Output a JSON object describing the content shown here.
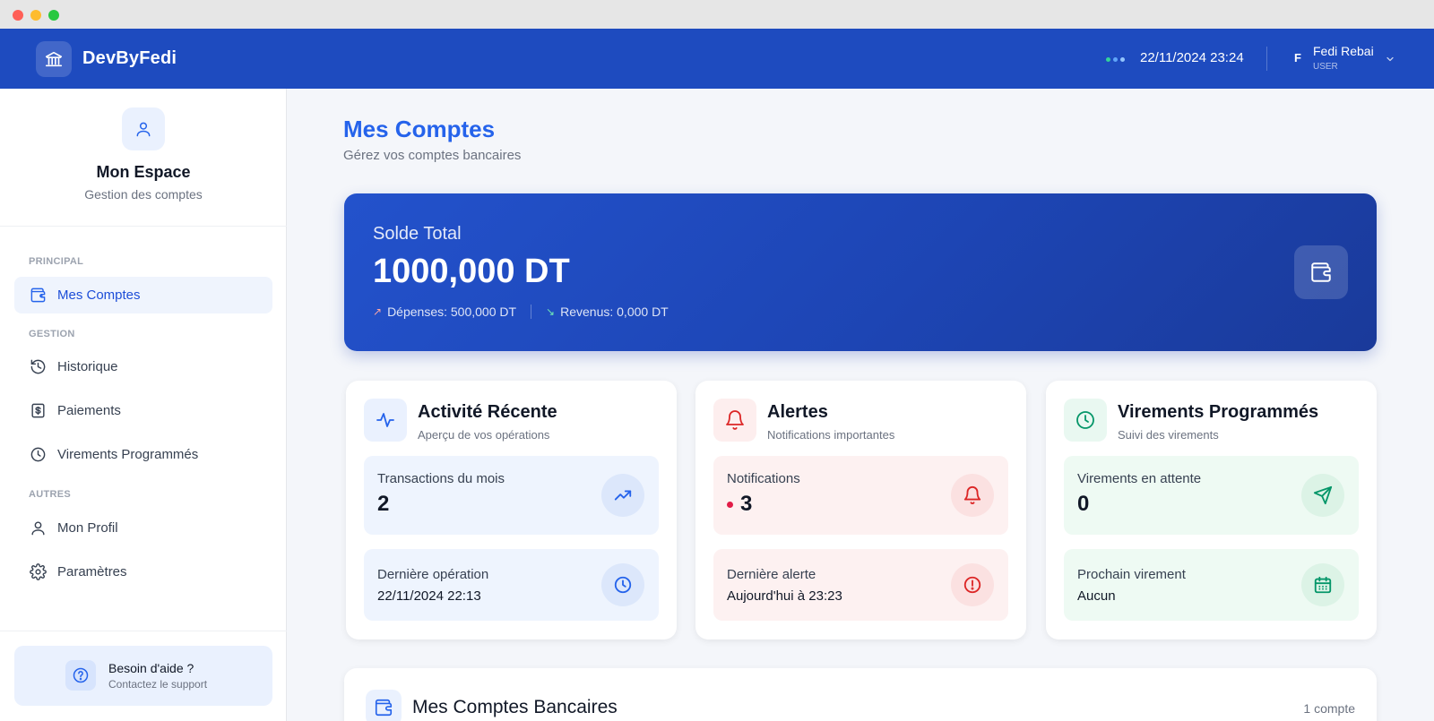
{
  "header": {
    "brand": "DevByFedi",
    "datetime": "22/11/2024 23:24",
    "user_initial": "F",
    "user_name": "Fedi Rebai",
    "user_role": "USER",
    "status_dot_colors": [
      "#34d399",
      "#60a5fa",
      "#93c5fd"
    ]
  },
  "sidebar": {
    "title": "Mon Espace",
    "subtitle": "Gestion des comptes",
    "sections": {
      "principal": "PRINCIPAL",
      "gestion": "GESTION",
      "autres": "AUTRES"
    },
    "items": [
      {
        "label": "Mes Comptes",
        "icon": "wallet-icon",
        "active": true
      },
      {
        "label": "Historique",
        "icon": "history-icon",
        "active": false
      },
      {
        "label": "Paiements",
        "icon": "receipt-icon",
        "active": false
      },
      {
        "label": "Virements Programmés",
        "icon": "clock-icon",
        "active": false
      },
      {
        "label": "Mon Profil",
        "icon": "user-icon",
        "active": false
      },
      {
        "label": "Paramètres",
        "icon": "gear-icon",
        "active": false
      }
    ],
    "help": {
      "title": "Besoin d'aide ?",
      "subtitle": "Contactez le support"
    }
  },
  "main": {
    "title": "Mes Comptes",
    "subtitle": "Gérez vos comptes bancaires",
    "balance": {
      "label": "Solde Total",
      "amount": "1000,000 DT",
      "expenses": "Dépenses: 500,000 DT",
      "income": "Revenus: 0,000 DT"
    },
    "cards": {
      "activity": {
        "title": "Activité Récente",
        "subtitle": "Aperçu de vos opérations",
        "tile1_label": "Transactions du mois",
        "tile1_value": "2",
        "tile2_label": "Dernière opération",
        "tile2_value": "22/11/2024 22:13"
      },
      "alerts": {
        "title": "Alertes",
        "subtitle": "Notifications importantes",
        "tile1_label": "Notifications",
        "tile1_value": "3",
        "tile2_label": "Dernière alerte",
        "tile2_value": "Aujourd'hui à 23:23"
      },
      "transfers": {
        "title": "Virements Programmés",
        "subtitle": "Suivi des virements",
        "tile1_label": "Virements en attente",
        "tile1_value": "0",
        "tile2_label": "Prochain virement",
        "tile2_value": "Aucun"
      }
    },
    "accounts": {
      "title": "Mes Comptes Bancaires",
      "count": "1 compte"
    }
  },
  "colors": {
    "primary": "#1e4bbf",
    "accent_blue": "#2563eb",
    "alert_red": "#dc2626",
    "success_green": "#059669"
  }
}
